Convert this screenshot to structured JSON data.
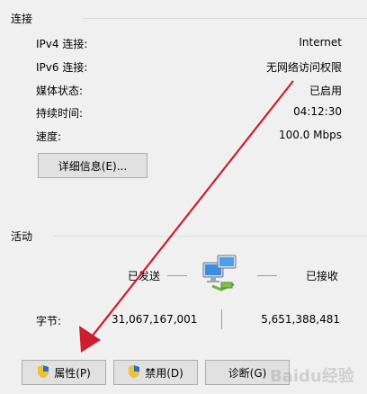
{
  "connection": {
    "title": "连接",
    "rows": [
      {
        "label": "IPv4 连接:",
        "value": "Internet"
      },
      {
        "label": "IPv6 连接:",
        "value": "无网络访问权限"
      },
      {
        "label": "媒体状态:",
        "value": "已启用"
      },
      {
        "label": "持续时间:",
        "value": "04:12:30"
      },
      {
        "label": "速度:",
        "value": "100.0 Mbps"
      }
    ],
    "details_button": "详细信息(E)..."
  },
  "activity": {
    "title": "活动",
    "sent_label": "已发送",
    "received_label": "已接收",
    "bytes_label": "字节:",
    "bytes_sent": "31,067,167,001",
    "bytes_received": "5,651,388,481"
  },
  "buttons": {
    "properties": "属性(P)",
    "disable": "禁用(D)",
    "diagnose": "诊断(G)"
  },
  "watermark": "Baidu经验",
  "colors": {
    "annotation_arrow": "#cc1f2d",
    "shield_blue": "#2f6cc6",
    "shield_yellow": "#f2c12e"
  }
}
